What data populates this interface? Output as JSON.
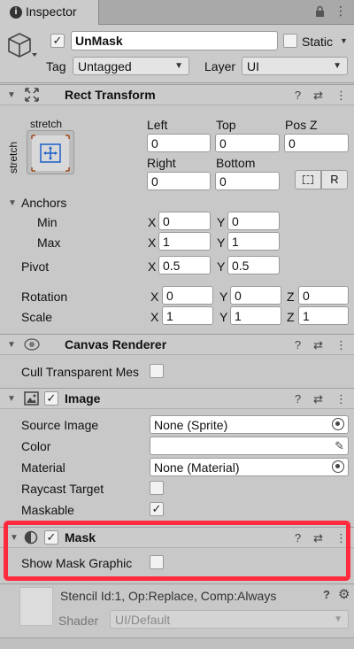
{
  "tab": {
    "title": "Inspector"
  },
  "object": {
    "name": "UnMask",
    "active": true,
    "static_label": "Static",
    "tag_label": "Tag",
    "tag_value": "Untagged",
    "layer_label": "Layer",
    "layer_value": "UI"
  },
  "rect_transform": {
    "title": "Rect Transform",
    "anchor_preset_top": "stretch",
    "anchor_preset_side": "stretch",
    "left_label": "Left",
    "top_label": "Top",
    "posz_label": "Pos Z",
    "left": "0",
    "top": "0",
    "posz": "0",
    "right_label": "Right",
    "bottom_label": "Bottom",
    "right": "0",
    "bottom": "0",
    "raw_button": "R",
    "anchors_label": "Anchors",
    "min_label": "Min",
    "max_label": "Max",
    "min_x": "0",
    "min_y": "0",
    "max_x": "1",
    "max_y": "1",
    "pivot_label": "Pivot",
    "pivot_x": "0.5",
    "pivot_y": "0.5",
    "rotation_label": "Rotation",
    "rot_x": "0",
    "rot_y": "0",
    "rot_z": "0",
    "scale_label": "Scale",
    "scale_x": "1",
    "scale_y": "1",
    "scale_z": "1",
    "x": "X",
    "y": "Y",
    "z": "Z"
  },
  "canvas_renderer": {
    "title": "Canvas Renderer",
    "cull_label": "Cull Transparent Mes",
    "cull": false
  },
  "image": {
    "title": "Image",
    "enabled": true,
    "source_label": "Source Image",
    "source_value": "None (Sprite)",
    "color_label": "Color",
    "color_value": "#ffffff",
    "material_label": "Material",
    "material_value": "None (Material)",
    "raycast_label": "Raycast Target",
    "raycast": false,
    "maskable_label": "Maskable",
    "maskable": true
  },
  "mask": {
    "title": "Mask",
    "enabled": true,
    "show_graphic_label": "Show Mask Graphic",
    "show_graphic": false,
    "highlight_color": "#ff2a3d"
  },
  "material_preview": {
    "info": "Stencil Id:1, Op:Replace, Comp:Always",
    "shader_label": "Shader",
    "shader_value": "UI/Default"
  },
  "checkmark": "✓"
}
